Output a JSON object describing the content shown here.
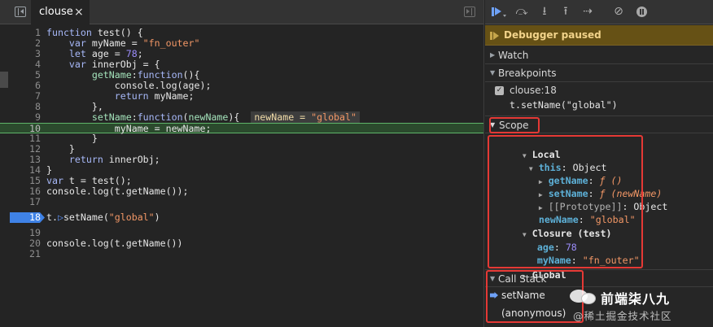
{
  "source": {
    "file_tab": "clouse",
    "close_glyph": "×",
    "lines": [
      {
        "n": "1",
        "parts": [
          {
            "c": "kw",
            "t": "function "
          },
          {
            "c": "fn",
            "t": "test() {"
          }
        ]
      },
      {
        "n": "2",
        "parts": [
          {
            "c": "",
            "t": "    "
          },
          {
            "c": "kw",
            "t": "var "
          },
          {
            "c": "fn",
            "t": "myName = "
          },
          {
            "c": "str",
            "t": "\"fn_outer\""
          }
        ]
      },
      {
        "n": "3",
        "parts": [
          {
            "c": "",
            "t": "    "
          },
          {
            "c": "kw",
            "t": "let "
          },
          {
            "c": "fn",
            "t": "age = "
          },
          {
            "c": "num",
            "t": "78"
          },
          {
            "c": "fn",
            "t": ";"
          }
        ]
      },
      {
        "n": "4",
        "parts": [
          {
            "c": "",
            "t": "    "
          },
          {
            "c": "kw",
            "t": "var "
          },
          {
            "c": "fn",
            "t": "innerObj = {"
          }
        ]
      },
      {
        "n": "5",
        "parts": [
          {
            "c": "",
            "t": "        "
          },
          {
            "c": "prop",
            "t": "getName"
          },
          {
            "c": "fn",
            "t": ":"
          },
          {
            "c": "kw",
            "t": "function"
          },
          {
            "c": "fn",
            "t": "(){"
          }
        ]
      },
      {
        "n": "6",
        "parts": [
          {
            "c": "",
            "t": "            "
          },
          {
            "c": "fn",
            "t": "console.log(age);"
          }
        ]
      },
      {
        "n": "7",
        "parts": [
          {
            "c": "",
            "t": "            "
          },
          {
            "c": "kw",
            "t": "return "
          },
          {
            "c": "fn",
            "t": "myName;"
          }
        ]
      },
      {
        "n": "8",
        "parts": [
          {
            "c": "",
            "t": "        "
          },
          {
            "c": "fn",
            "t": "},"
          }
        ]
      },
      {
        "n": "9",
        "parts": [
          {
            "c": "",
            "t": "        "
          },
          {
            "c": "prop",
            "t": "setName"
          },
          {
            "c": "fn",
            "t": ":"
          },
          {
            "c": "kw",
            "t": "function"
          },
          {
            "c": "fn",
            "t": "("
          },
          {
            "c": "prop",
            "t": "newName"
          },
          {
            "c": "fn",
            "t": "){  "
          },
          {
            "c": "inline",
            "t": ""
          }
        ]
      },
      {
        "n": "10",
        "parts": [
          {
            "c": "",
            "t": "            "
          },
          {
            "c": "fn",
            "t": "myName = newName;"
          }
        ]
      },
      {
        "n": "11",
        "parts": [
          {
            "c": "",
            "t": "        "
          },
          {
            "c": "fn",
            "t": "}"
          }
        ]
      },
      {
        "n": "12",
        "parts": [
          {
            "c": "",
            "t": "    "
          },
          {
            "c": "fn",
            "t": "}"
          }
        ]
      },
      {
        "n": "13",
        "parts": [
          {
            "c": "",
            "t": "    "
          },
          {
            "c": "kw",
            "t": "return "
          },
          {
            "c": "fn",
            "t": "innerObj;"
          }
        ]
      },
      {
        "n": "14",
        "parts": [
          {
            "c": "fn",
            "t": "}"
          }
        ]
      },
      {
        "n": "15",
        "parts": [
          {
            "c": "kw",
            "t": "var "
          },
          {
            "c": "fn",
            "t": "t = test();"
          }
        ]
      },
      {
        "n": "16",
        "parts": [
          {
            "c": "fn",
            "t": "console.log(t.getName());"
          }
        ]
      },
      {
        "n": "17",
        "parts": []
      },
      {
        "n": "18",
        "parts": [
          {
            "c": "exec",
            "t": "t."
          },
          {
            "c": "exec-arrow",
            "t": "▷"
          },
          {
            "c": "fn",
            "t": "setName("
          },
          {
            "c": "str",
            "t": "\"global\""
          },
          {
            "c": "fn",
            "t": ")"
          }
        ]
      },
      {
        "n": "19",
        "parts": []
      },
      {
        "n": "20",
        "parts": [
          {
            "c": "fn",
            "t": "console.log(t.getName())"
          }
        ]
      },
      {
        "n": "21",
        "parts": []
      }
    ],
    "inline_value_name": "newName = ",
    "inline_value_str": "\"global\""
  },
  "debugger": {
    "paused_text": "Debugger paused",
    "sections": {
      "watch": "Watch",
      "breakpoints": "Breakpoints",
      "scope": "Scope",
      "call_stack": "Call Stack"
    },
    "breakpoint": {
      "location": "clouse:18",
      "code": "t.setName(\"global\")",
      "checked": "✓"
    },
    "scope": {
      "local": "Local",
      "this_name": "this",
      "this_value": "Object",
      "getName_key": "getName",
      "getName_val": "ƒ ()",
      "setName_key": "setName",
      "setName_val": "ƒ (newName)",
      "proto_key": "[[Prototype]]",
      "proto_val": "Object",
      "newName_key": "newName",
      "newName_val": "\"global\"",
      "closure": "Closure (test)",
      "age_key": "age",
      "age_val": "78",
      "myName_key": "myName",
      "myName_val": "\"fn_outer\"",
      "global": "Global",
      "sep": ": "
    },
    "call_stack": {
      "frames": [
        "setName",
        "(anonymous)"
      ]
    }
  },
  "toolbar_icons": {
    "step_over": "⤼",
    "step_into": "⭳",
    "step_out": "⭱",
    "step": "⇢",
    "deactivate": "⊘"
  },
  "watermark": {
    "title": "前端柒八九",
    "subtitle": "@稀土掘金技术社区"
  },
  "colors": {
    "paused_banner": "#665115",
    "current_line": "#2b4a2d",
    "annotation": "#e53935",
    "breakpoint": "#3f82e6"
  }
}
